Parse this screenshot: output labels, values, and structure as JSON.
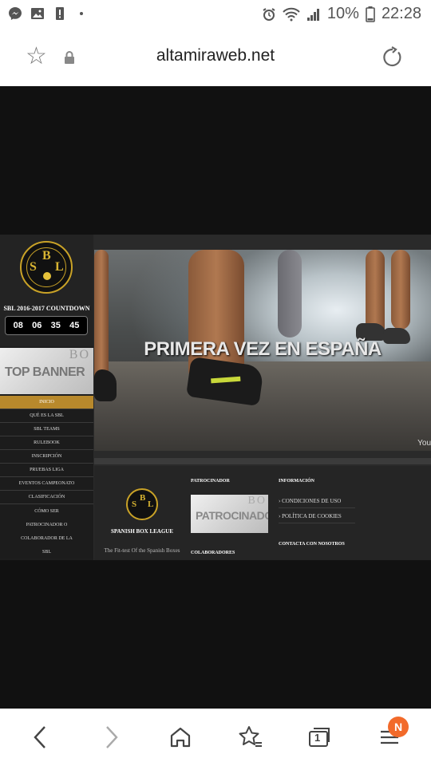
{
  "status_bar": {
    "battery": "10%",
    "time": "22:28",
    "icons": [
      "messenger-icon",
      "gallery-icon",
      "alert-icon",
      "dot-icon",
      "alarm-icon",
      "wifi-icon",
      "signal-icon",
      "battery-icon"
    ]
  },
  "browser": {
    "url": "altamiraweb.net",
    "tab_count": "1",
    "notification_badge": "N"
  },
  "site": {
    "countdown_title": "SBL 2016-2017 COUNTDOWN",
    "countdown": {
      "days": "08",
      "hours": "06",
      "minutes": "35",
      "seconds": "45"
    },
    "top_banner": "TOP BANNER",
    "banner_watermark": "BO",
    "logo_letters": [
      "S",
      "B",
      "L"
    ],
    "menu": [
      "INICIO",
      "QUÉ ES LA SBL",
      "SBL TEAMS",
      "RULEBOOK",
      "INSCRIPCIÓN",
      "PRUEBAS LIGA",
      "EVENTOS CAMPEONATO",
      "CLASIFICACIÓN",
      "CÓMO SER",
      "PATROCINADOR O",
      "COLABORADOR DE LA",
      "SBL"
    ],
    "hero_headline": "PRIMERA VEZ EN ESPAÑA",
    "hero_watermark": "You",
    "footer": {
      "name": "SPANISH BOX LEAGUE",
      "tagline": "The Fit-test Of the Spanish Boxes",
      "sponsor_title": "PATROCINADOR",
      "sponsor_banner": "PATROCINADOR",
      "collaborators_title": "COLABORADORES",
      "info_title": "INFORMACIÓN",
      "info_links": [
        "› CONDICIONES DE USO",
        "› POLÍTICA DE COOKIES"
      ],
      "contact_title": "CONTACTA CON NOSOTROS"
    }
  },
  "colors": {
    "accent_gold": "#c9a227",
    "menu_active": "#b8892c",
    "badge": "#f26a2a"
  }
}
